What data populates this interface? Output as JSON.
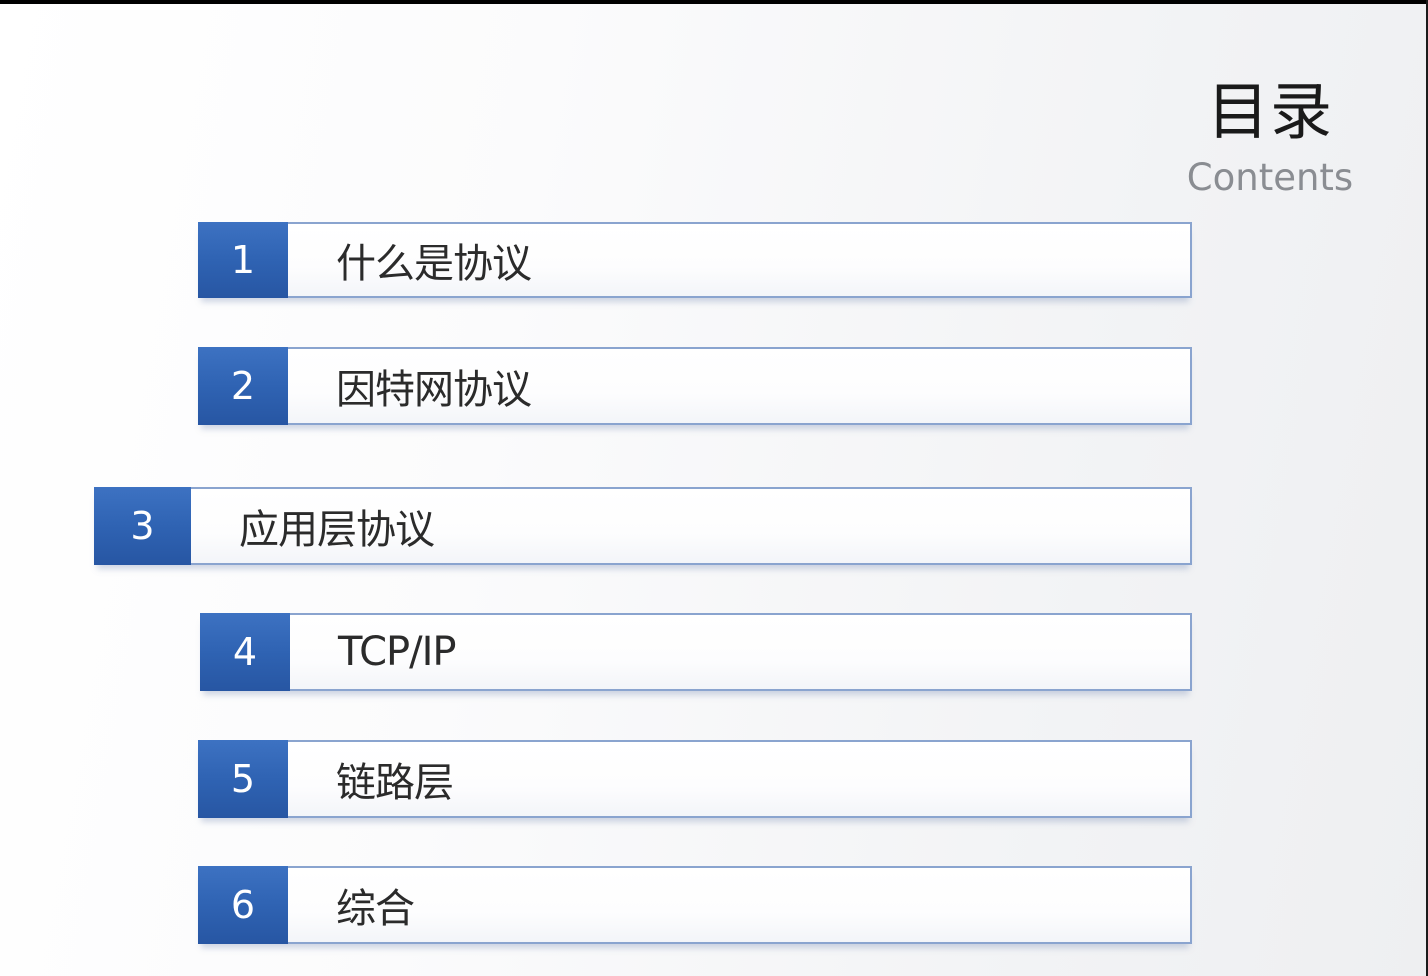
{
  "heading": {
    "title": "目录",
    "subtitle": "Contents"
  },
  "toc": [
    {
      "number": "1",
      "label": "什么是协议"
    },
    {
      "number": "2",
      "label": "因特网协议"
    },
    {
      "number": "3",
      "label": "应用层协议"
    },
    {
      "number": "4",
      "label": "TCP/IP"
    },
    {
      "number": "5",
      "label": "链路层"
    },
    {
      "number": "6",
      "label": "综合"
    }
  ],
  "colors": {
    "accent": "#2f63b3",
    "border": "#8aa4cf",
    "text": "#2b2b2b",
    "subtitle": "#8a8d92"
  }
}
